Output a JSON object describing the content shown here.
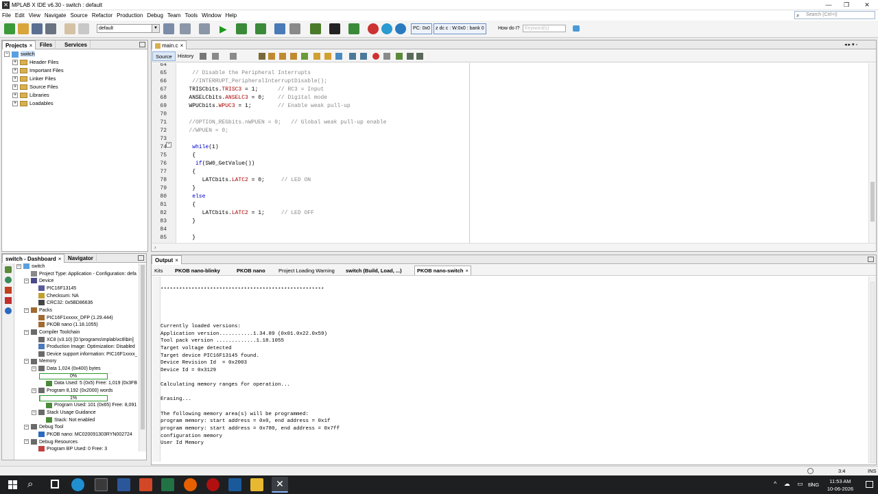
{
  "window": {
    "title": "MPLAB X IDE v6.30 - switch : default",
    "app_icon": "mplab-x-icon"
  },
  "menu": [
    "File",
    "Edit",
    "View",
    "Navigate",
    "Source",
    "Refactor",
    "Production",
    "Debug",
    "Team",
    "Tools",
    "Window",
    "Help"
  ],
  "search": {
    "placeholder": "Search (Ctrl+I)"
  },
  "toolbar": {
    "config": "default",
    "pc": "PC: 0x0",
    "status": "z dc c  : W:0x0 : bank 0",
    "how_do_i": "How do I?",
    "keyword_placeholder": "Keyword(s)"
  },
  "projects_panel": {
    "tabs": [
      "Projects",
      "Files",
      "Services"
    ],
    "root": "switch",
    "items": [
      "Header Files",
      "Important Files",
      "Linker Files",
      "Source Files",
      "Libraries",
      "Loadables"
    ]
  },
  "dashboard": {
    "tabs": [
      "switch - Dashboard",
      "Navigator"
    ],
    "rows": [
      {
        "t": "switch",
        "lvl": 0
      },
      {
        "t": "Project Type: Application - Configuration: defa",
        "lvl": 1
      },
      {
        "t": "Device",
        "lvl": 1
      },
      {
        "t": "PIC16F13145",
        "lvl": 2
      },
      {
        "t": "Checksum: NA",
        "lvl": 2
      },
      {
        "t": "CRC32: 0x5BD86636",
        "lvl": 2
      },
      {
        "t": "Packs",
        "lvl": 1
      },
      {
        "t": "PIC16F1xxxxx_DFP (1.29.444)",
        "lvl": 2
      },
      {
        "t": "PKOB nano (1.18.1055)",
        "lvl": 2
      },
      {
        "t": "Compiler Toolchain",
        "lvl": 1
      },
      {
        "t": "XC8 (v3.10) [D:\\programs\\mplab\\xc8\\bin]",
        "lvl": 2
      },
      {
        "t": "Production Image: Optimization: Disabled",
        "lvl": 2
      },
      {
        "t": "Device support information: PIC16F1xxxx_",
        "lvl": 2
      },
      {
        "t": "Memory",
        "lvl": 1
      },
      {
        "t": "Data 1,024 (0x400) bytes",
        "lvl": 2
      },
      {
        "t": "0%",
        "lvl": 3,
        "bar": 0
      },
      {
        "t": "Data Used: 5 (0x5) Free: 1,019 (0x3FB",
        "lvl": 3
      },
      {
        "t": "Program 8,192 (0x2000) words",
        "lvl": 2
      },
      {
        "t": "1%",
        "lvl": 3,
        "bar": 1
      },
      {
        "t": "Program Used: 101 (0x65) Free: 8,091",
        "lvl": 3
      },
      {
        "t": "Stack Usage Guidance",
        "lvl": 2
      },
      {
        "t": "Stack: Not enabled",
        "lvl": 3
      },
      {
        "t": "Debug Tool",
        "lvl": 1
      },
      {
        "t": "PKOB nano: MC020091303RYN002724",
        "lvl": 2
      },
      {
        "t": "Debug Resources",
        "lvl": 1
      },
      {
        "t": "Program BP Used: 0  Free: 3",
        "lvl": 2
      }
    ]
  },
  "editor": {
    "file_tab": "main.c",
    "subtabs": [
      "Source",
      "History"
    ],
    "lines": [
      {
        "n": "64",
        "c": ""
      },
      {
        "n": "65",
        "c": "    // Disable the Peripheral Interrupts",
        "k": "cm"
      },
      {
        "n": "66",
        "c": "    //INTERRUPT_PeripheralInterruptDisable();",
        "k": "cm"
      },
      {
        "n": "67",
        "c": "   TRISCbits.TRISC3 = 1;      // RC3 = Input"
      },
      {
        "n": "68",
        "c": "   ANSELCbits.ANSELC3 = 0;    // Digital mode"
      },
      {
        "n": "69",
        "c": "   WPUCbits.WPUC3 = 1;        // Enable weak pull-up"
      },
      {
        "n": "70",
        "c": ""
      },
      {
        "n": "71",
        "c": "   //OPTION_REGbits.nWPUEN = 0;   // Global weak pull-up enable",
        "k": "cm"
      },
      {
        "n": "72",
        "c": "   //WPUEN = 0;",
        "k": "cm"
      },
      {
        "n": "73",
        "c": ""
      },
      {
        "n": "74",
        "c": "    while(1)"
      },
      {
        "n": "75",
        "c": "    {"
      },
      {
        "n": "76",
        "c": "     if(SW0_GetValue())"
      },
      {
        "n": "77",
        "c": "    {"
      },
      {
        "n": "78",
        "c": "       LATCbits.LATC2 = 0;     // LED ON"
      },
      {
        "n": "79",
        "c": "    }"
      },
      {
        "n": "80",
        "c": "    else"
      },
      {
        "n": "81",
        "c": "    {"
      },
      {
        "n": "82",
        "c": "       LATCbits.LATC2 = 1;     // LED OFF"
      },
      {
        "n": "83",
        "c": "    }"
      },
      {
        "n": "84",
        "c": ""
      },
      {
        "n": "85",
        "c": "    }"
      }
    ]
  },
  "output": {
    "title": "Output",
    "tabs": [
      "Kits",
      "PKOB nano-blinky",
      "PKOB nano",
      "Project Loading Warning",
      "switch (Build, Load, ...)",
      "PKOB nano-switch"
    ],
    "lines": [
      "",
      "*****************************************************",
      "",
      "",
      "",
      "",
      "Currently loaded versions:",
      "Application version...........1.34.89 (0x01.0x22.0x59)",
      "Tool pack version .............1.18.1055",
      "Target voltage detected",
      "Target device PIC16F13145 found.",
      "Device Revision Id  = 0x2003",
      "Device Id = 0x3129",
      "",
      "Calculating memory ranges for operation...",
      "",
      "Erasing...",
      "",
      "The following memory area(s) will be programmed:",
      "program memory: start address = 0x0, end address = 0x1f",
      "program memory: start address = 0x780, end address = 0x7ff",
      "configuration memory",
      "User Id Memory"
    ]
  },
  "statusbar": {
    "position": "3:4",
    "mode": "INS"
  },
  "taskbar": {
    "lang": "ENG",
    "time": "11:53 AM",
    "date": "10-06-2026"
  }
}
